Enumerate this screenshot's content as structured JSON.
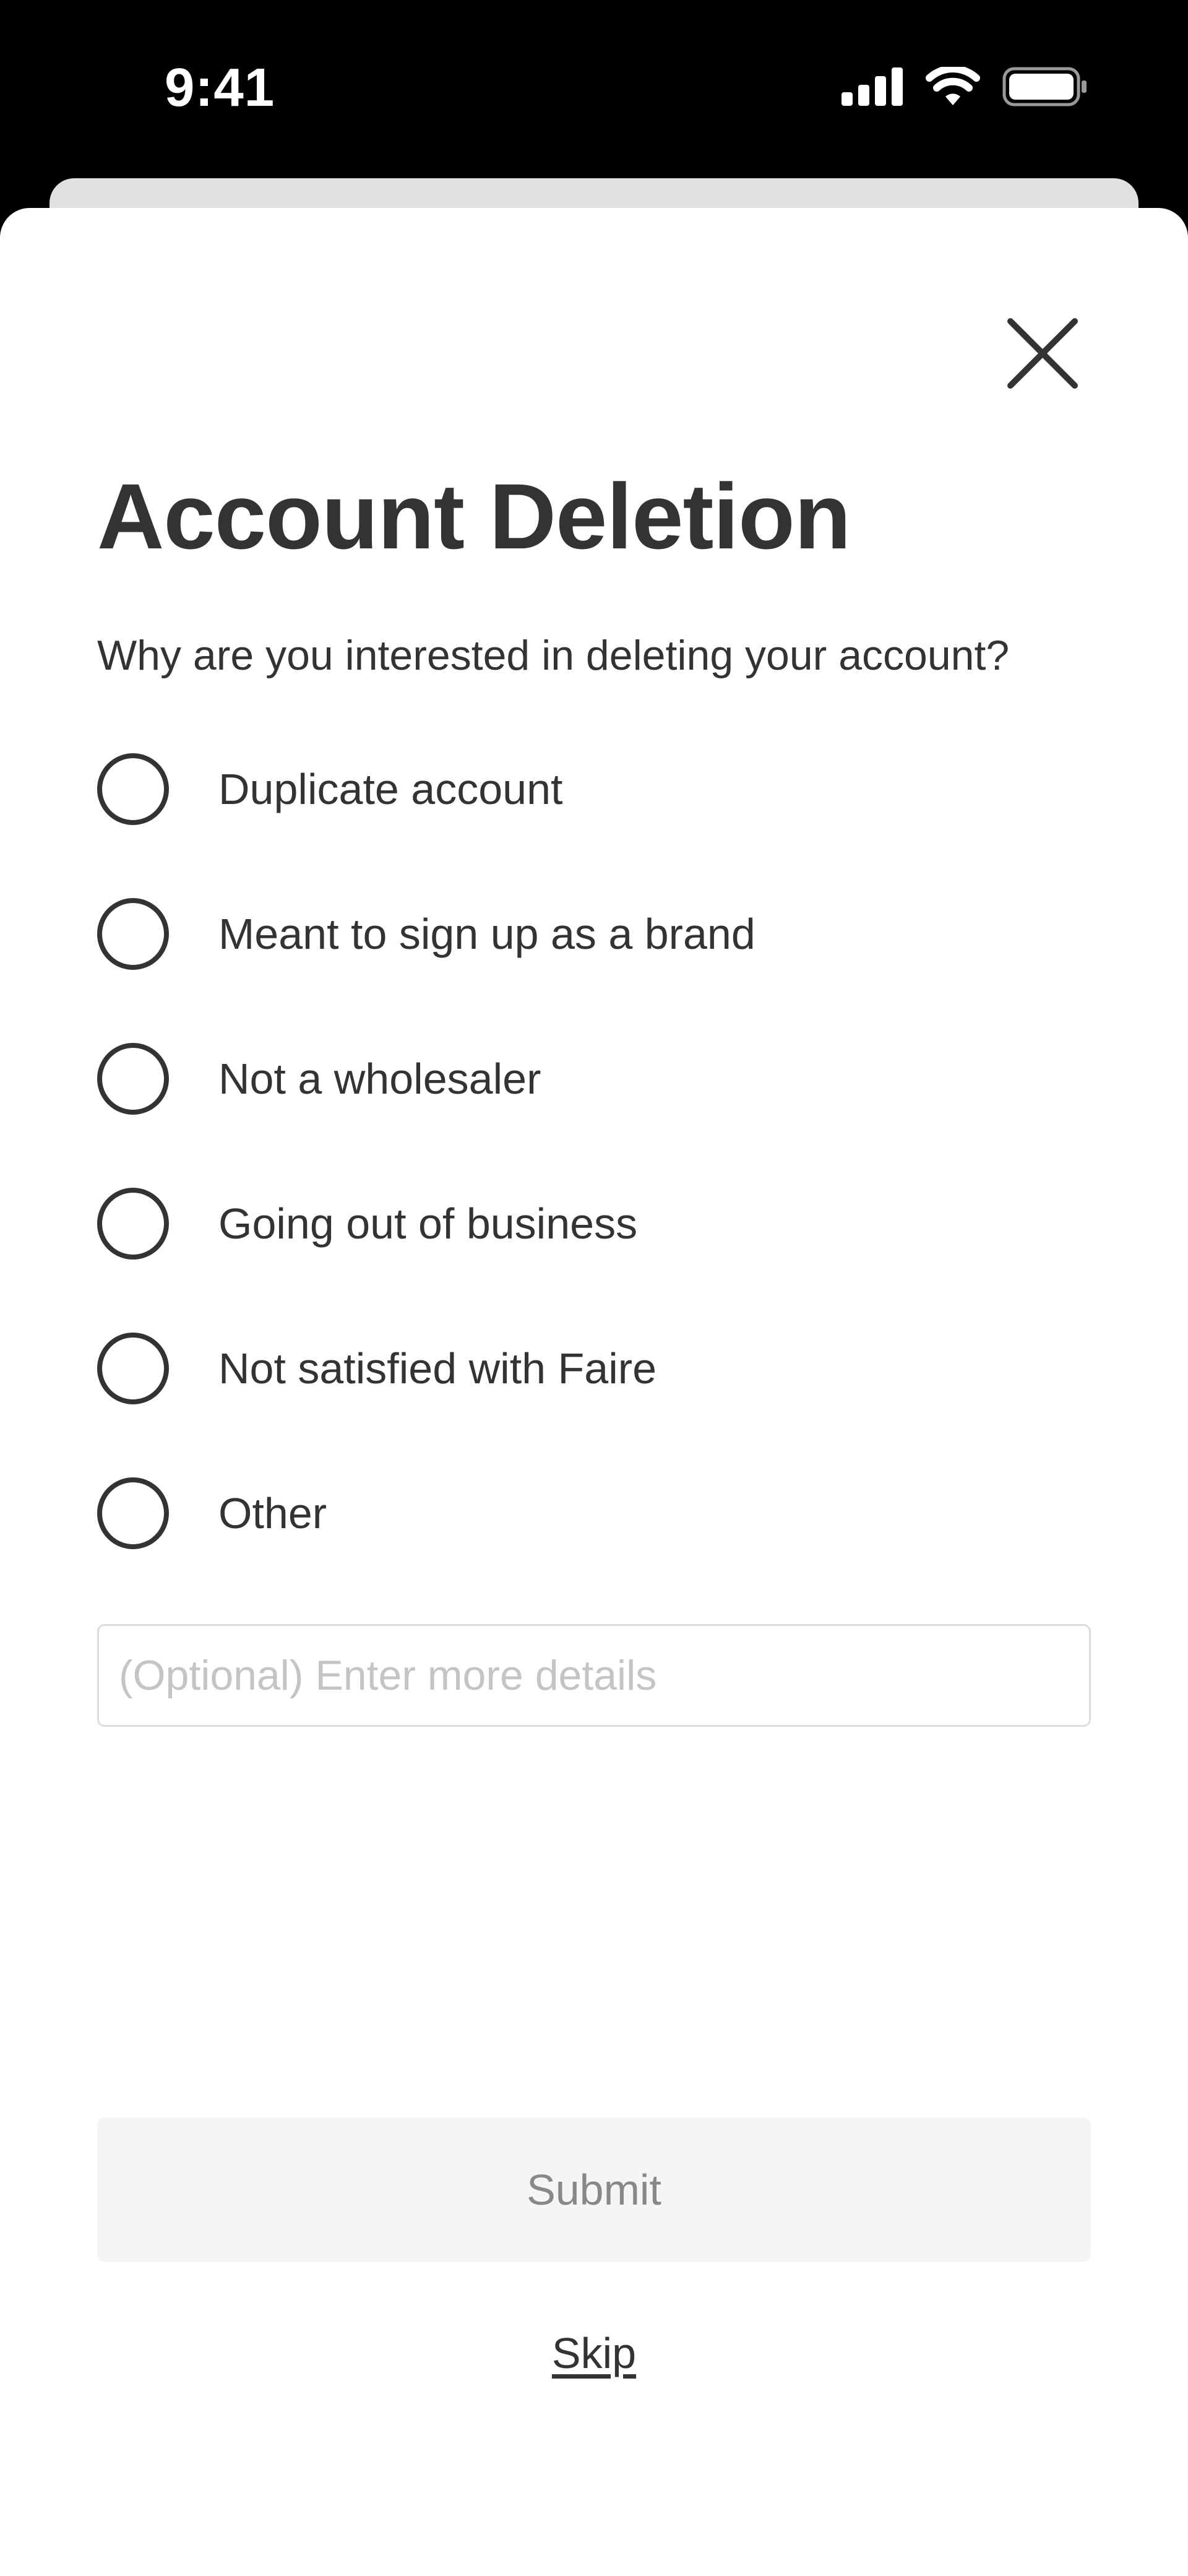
{
  "status_bar": {
    "time": "9:41",
    "icons": [
      "cellular-signal-icon",
      "wifi-icon",
      "battery-icon"
    ]
  },
  "modal": {
    "title": "Account Deletion",
    "question": "Why are you interested in deleting your account?",
    "options": [
      {
        "label": "Duplicate account",
        "selected": false
      },
      {
        "label": "Meant to sign up as a brand",
        "selected": false
      },
      {
        "label": "Not a wholesaler",
        "selected": false
      },
      {
        "label": "Going out of business",
        "selected": false
      },
      {
        "label": "Not satisfied with Faire",
        "selected": false
      },
      {
        "label": "Other",
        "selected": false
      }
    ],
    "details_field": {
      "value": "",
      "placeholder": "(Optional) Enter more details"
    },
    "submit_label": "Submit",
    "skip_label": "Skip",
    "close_icon": "close-icon"
  },
  "colors": {
    "text": "#333333",
    "submit_bg": "#f5f5f5",
    "submit_text": "#888888",
    "placeholder": "#c4c4c4",
    "status_bar_bg": "#000000"
  }
}
